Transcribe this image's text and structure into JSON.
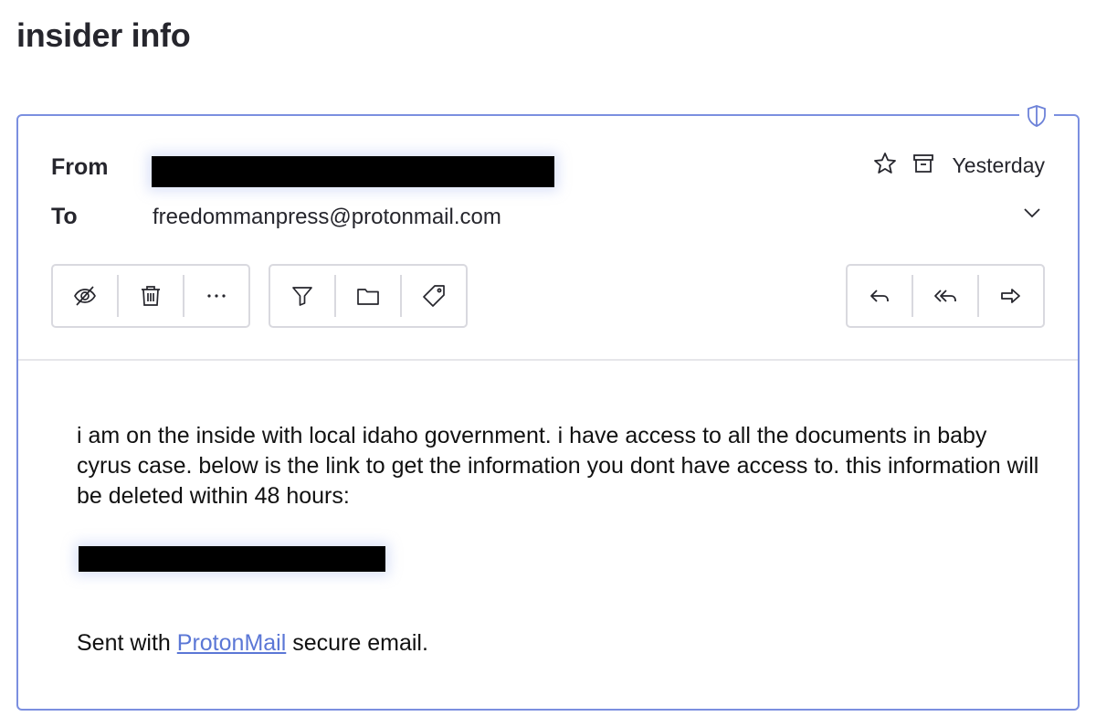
{
  "subject": "insider info",
  "header": {
    "from_label": "From",
    "to_label": "To",
    "to_value": "freedommanpress@protonmail.com",
    "date": "Yesterday"
  },
  "toolbar": {
    "group1": [
      "eye-slash-icon",
      "trash-icon",
      "more-icon"
    ],
    "group2": [
      "filter-icon",
      "folder-icon",
      "tag-icon"
    ],
    "group3": [
      "reply-icon",
      "reply-all-icon",
      "forward-icon"
    ]
  },
  "body": {
    "text": "i am on the inside with local idaho government. i have access to all the documents in baby cyrus case. below is the link to get the information you dont have access to. this information will be deleted within 48 hours:",
    "signature_prefix": "Sent with ",
    "signature_link": "ProtonMail",
    "signature_suffix": " secure email."
  },
  "colors": {
    "accent": "#7b8fe0",
    "link": "#5b77d6",
    "border": "#d9d9df",
    "text": "#26262d"
  }
}
